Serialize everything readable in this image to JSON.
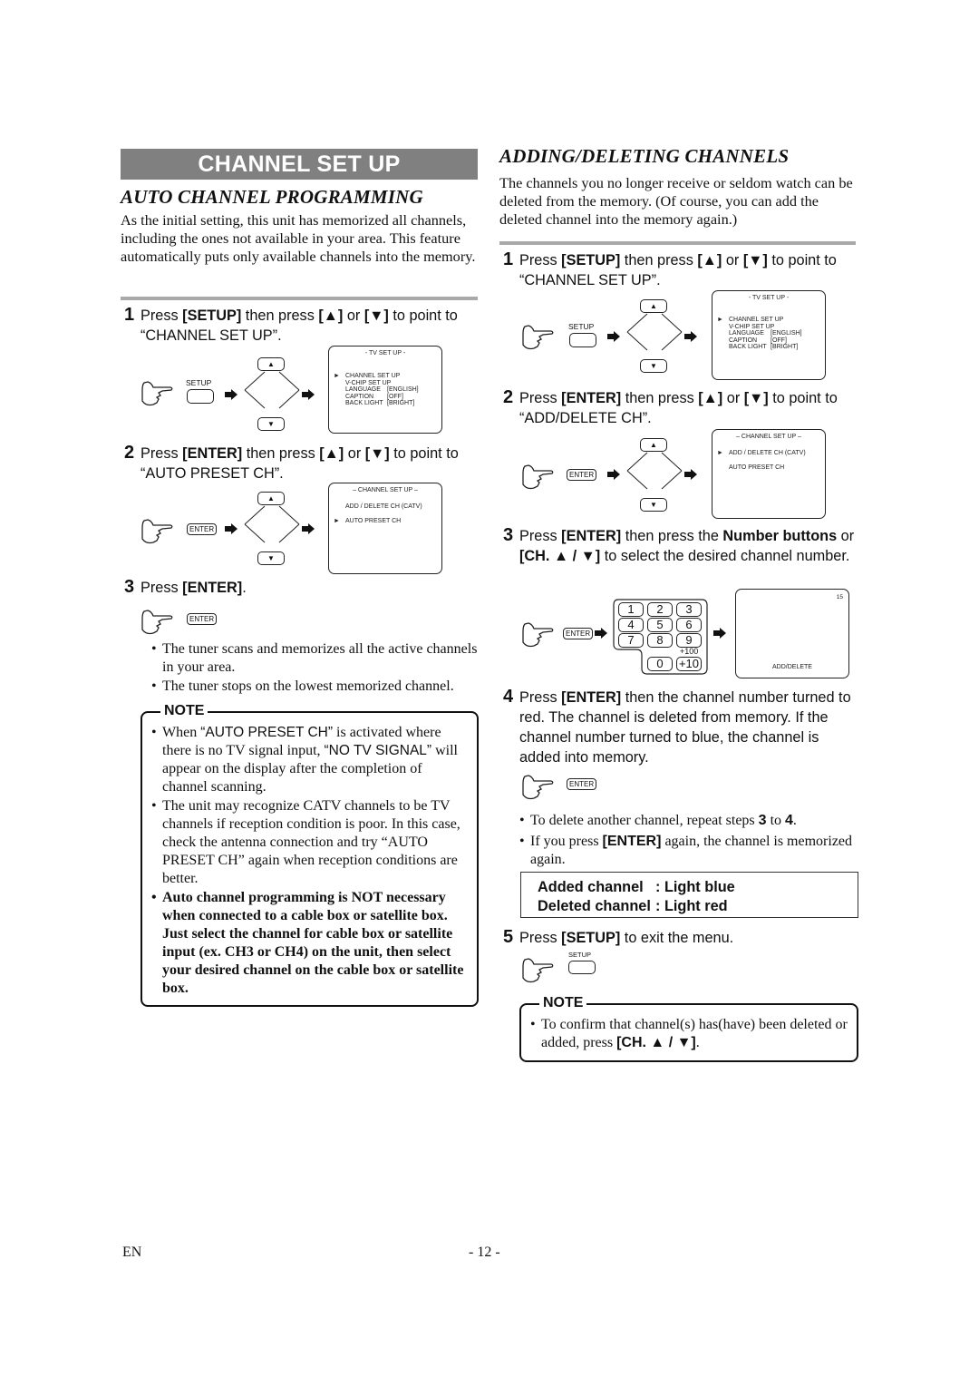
{
  "left": {
    "banner_title": "CHANNEL SET UP",
    "section_title": "AUTO CHANNEL PROGRAMMING",
    "intro": "As the initial setting, this unit has memorized all channels, including the ones not available in your area. This feature automatically puts only available channels into the memory.",
    "step1": {
      "num": "1",
      "pre": "Press ",
      "key": "[SETUP]",
      "mid": " then press ",
      "up": "[▲]",
      "or": " or ",
      "down": "[▼]",
      "post": " to point to “CHANNEL SET UP”."
    },
    "step2": {
      "num": "2",
      "pre": "Press ",
      "key": "[ENTER]",
      "mid": " then press ",
      "up": "[▲]",
      "or": " or ",
      "down": "[▼]",
      "post": " to point to “AUTO PRESET CH”."
    },
    "step3": {
      "num": "3",
      "pre": "Press ",
      "key": "[ENTER]",
      "post": "."
    },
    "bullets": [
      "The tuner scans and memorizes all the active channels in your area.",
      "The tuner stops on the lowest memorized channel."
    ],
    "note": {
      "label": "NOTE",
      "item1": {
        "a": "When ",
        "b": "“AUTO PRESET CH”",
        "c": " is activated where there is no TV signal input, ",
        "d": "“NO TV SIGNAL”",
        "e": " will appear on the display after the completion of channel scanning."
      },
      "item2": "The unit may recognize CATV channels to be TV channels if reception condition is poor. In this case, check the antenna connection and try “AUTO PRESET CH” again when reception conditions are better.",
      "item3": "Auto channel programming is NOT necessary when connected to a cable box or satellite box. Just select the channel for cable box or satellite input (ex. CH3 or CH4) on the unit, then select your desired channel on the cable box or satellite box."
    }
  },
  "right": {
    "section_title": "ADDING/DELETING CHANNELS",
    "intro": "The channels you no longer receive or seldom watch can be deleted from the memory. (Of course, you can add the deleted channel into the memory again.)",
    "step1": {
      "num": "1",
      "pre": "Press ",
      "key": "[SETUP]",
      "mid": " then press ",
      "up": "[▲]",
      "or": " or ",
      "down": "[▼]",
      "post": " to point to “CHANNEL SET UP”."
    },
    "step2": {
      "num": "2",
      "pre": "Press ",
      "key": "[ENTER]",
      "mid": " then press ",
      "up": "[▲]",
      "or": " or ",
      "down": "[▼]",
      "post": " to point to “ADD/DELETE CH”."
    },
    "step3": {
      "num": "3",
      "pre": "Press ",
      "key": "[ENTER]",
      "mid": " then press the ",
      "bold1": "Number buttons",
      "or": " or ",
      "bold2": "[CH. ▲ / ▼]",
      "post": " to select the desired channel number."
    },
    "step4": {
      "num": "4",
      "pre": "Press ",
      "key": "[ENTER]",
      "post": " then the channel number turned to red. The channel is deleted from memory. If the channel number turned to blue, the channel is added into memory."
    },
    "bullets": {
      "b1_pre": "To delete another channel, repeat steps ",
      "b1_s3": "3",
      "b1_to": " to ",
      "b1_s4": "4",
      "b1_end": ".",
      "b2_pre": "If you press ",
      "b2_key": "[ENTER]",
      "b2_post": " again, the channel is memorized again."
    },
    "legend": [
      {
        "label": "Added channel",
        "value": ": Light blue"
      },
      {
        "label": "Deleted channel",
        "value": ": Light red"
      }
    ],
    "step5": {
      "num": "5",
      "pre": "Press ",
      "key": "[SETUP]",
      "post": " to exit the menu."
    },
    "note": {
      "label": "NOTE",
      "pre": "To confirm that channel(s) has(have) been deleted or added, press ",
      "key": "[CH. ▲ / ▼]",
      "post": "."
    }
  },
  "diagrams": {
    "setup_label": "SETUP",
    "enter_label": "ENTER",
    "up_glyph": "▲",
    "down_glyph": "▼",
    "cursor_glyph": "►",
    "tv_setup_screen": {
      "title": "- TV SET UP -",
      "items": [
        {
          "label": "CHANNEL SET UP",
          "value": ""
        },
        {
          "label": "V-CHIP SET UP",
          "value": ""
        },
        {
          "label": "LANGUAGE",
          "value": "[ENGLISH]"
        },
        {
          "label": "CAPTION",
          "value": "[OFF]"
        },
        {
          "label": "BACK LIGHT",
          "value": "[BRIGHT]"
        }
      ],
      "selected_index": 0
    },
    "channel_setup_screen": {
      "title": "– CHANNEL SET UP –",
      "items": [
        "ADD / DELETE CH (CATV)",
        "AUTO PRESET CH"
      ]
    },
    "left_step2_selected": "AUTO PRESET CH",
    "right_step2_selected": "ADD / DELETE CH (CATV)",
    "numpad": {
      "keys": [
        "1",
        "2",
        "3",
        "4",
        "5",
        "6",
        "7",
        "8",
        "9",
        "0",
        "+10"
      ],
      "extra_label": "+100"
    },
    "channel_screen": {
      "channel": "15",
      "caption": "ADD/DELETE"
    }
  },
  "footer": {
    "lang": "EN",
    "page": "- 12 -"
  }
}
